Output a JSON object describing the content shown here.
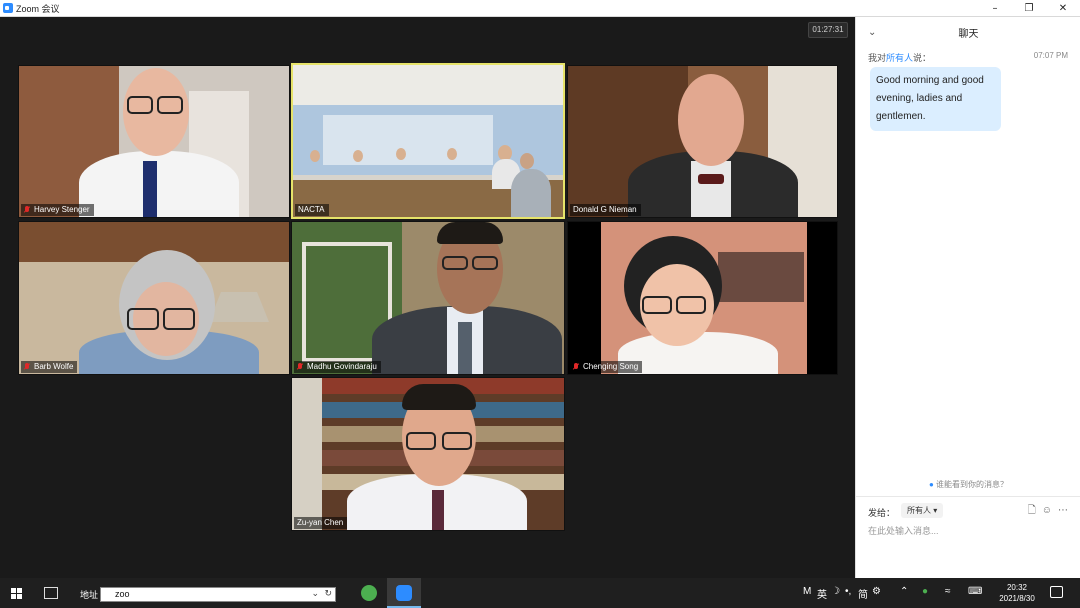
{
  "window": {
    "title": "Zoom 会议",
    "minimize_icon": "minimize-icon",
    "restore_icon": "restore-icon",
    "close_icon": "close-icon"
  },
  "meeting": {
    "timer": "01:27:31",
    "participants": [
      {
        "name": "Harvey Stenger",
        "muted": true
      },
      {
        "name": "NACTA",
        "muted": false,
        "active": true
      },
      {
        "name": "Donald G Nieman",
        "muted": false
      },
      {
        "name": "Barb Wolfe",
        "muted": true
      },
      {
        "name": "Madhu Govindaraju",
        "muted": true
      },
      {
        "name": "Chenging Song",
        "muted": true
      },
      {
        "name": "Zu-yan Chen",
        "muted": false
      }
    ]
  },
  "chat": {
    "title": "聊天",
    "sender_prefix": "我对",
    "sender_target": "所有人",
    "sender_suffix": "说：",
    "time": "07:07 PM",
    "message": "Good morning and good evening, ladies and gentlemen.",
    "who_can_see": "谁能看到你的消息？",
    "send_to_label": "发给：",
    "recipient": "所有人",
    "input_placeholder": "在此处输入消息..."
  },
  "taskbar": {
    "address_label": "地址",
    "address_value": "zoo",
    "tray_ime_1": "M",
    "tray_ime_2": "英",
    "tray_ime_3": "简",
    "clock_time": "20:32",
    "clock_date": "2021/8/30"
  },
  "colors": {
    "zoom_blue": "#2d8cff",
    "active_speaker_border": "#e6e36a",
    "muted_red": "#e02828",
    "chat_bubble": "#dbeeff"
  }
}
